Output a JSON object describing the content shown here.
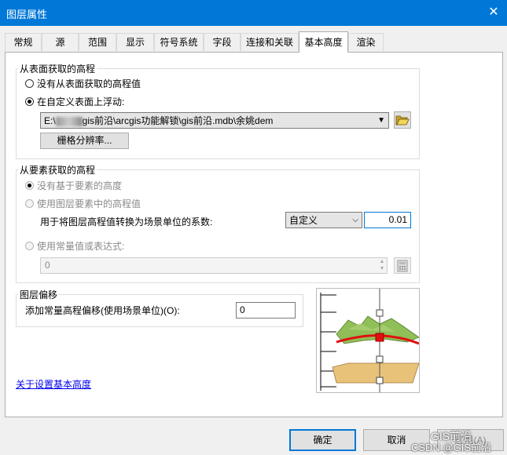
{
  "window": {
    "title": "图层属性"
  },
  "tabs": [
    {
      "label": "常规"
    },
    {
      "label": "源"
    },
    {
      "label": "范围"
    },
    {
      "label": "显示"
    },
    {
      "label": "符号系统"
    },
    {
      "label": "字段"
    },
    {
      "label": "连接和关联"
    },
    {
      "label": "基本高度"
    },
    {
      "label": "渲染"
    }
  ],
  "surface": {
    "legend": "从表面获取的高程",
    "opt_none": "没有从表面获取的高程值",
    "opt_float": "在自定义表面上浮动:",
    "path_prefix": "E:\\",
    "path_suffix": "gis前沿\\arcgis功能解锁\\gis前沿.mdb\\余姚dem",
    "raster_btn": "栅格分辨率..."
  },
  "features": {
    "legend": "从要素获取的高程",
    "opt_none": "没有基于要素的高度",
    "opt_field": "使用图层要素中的高程值",
    "factor_label": "用于将图层高程值转换为场景单位的系数:",
    "factor_combo": "自定义",
    "factor_value": "0.01",
    "opt_expr": "使用常量值或表达式:",
    "expr_value": "0"
  },
  "offset": {
    "legend": "图层偏移",
    "label": "添加常量高程偏移(使用场景单位)(O):",
    "value": "0"
  },
  "link": "关于设置基本高度",
  "buttons": {
    "ok": "确定",
    "cancel": "取消",
    "apply": "应用(A)"
  },
  "watermark": {
    "brand": "GIS前沿",
    "csdn": "CSDN @GIS前沿"
  },
  "icons": {
    "folder": "folder-open-icon",
    "calc": "calculator-icon",
    "close": "close-icon",
    "diagram": "base-height-diagram"
  }
}
